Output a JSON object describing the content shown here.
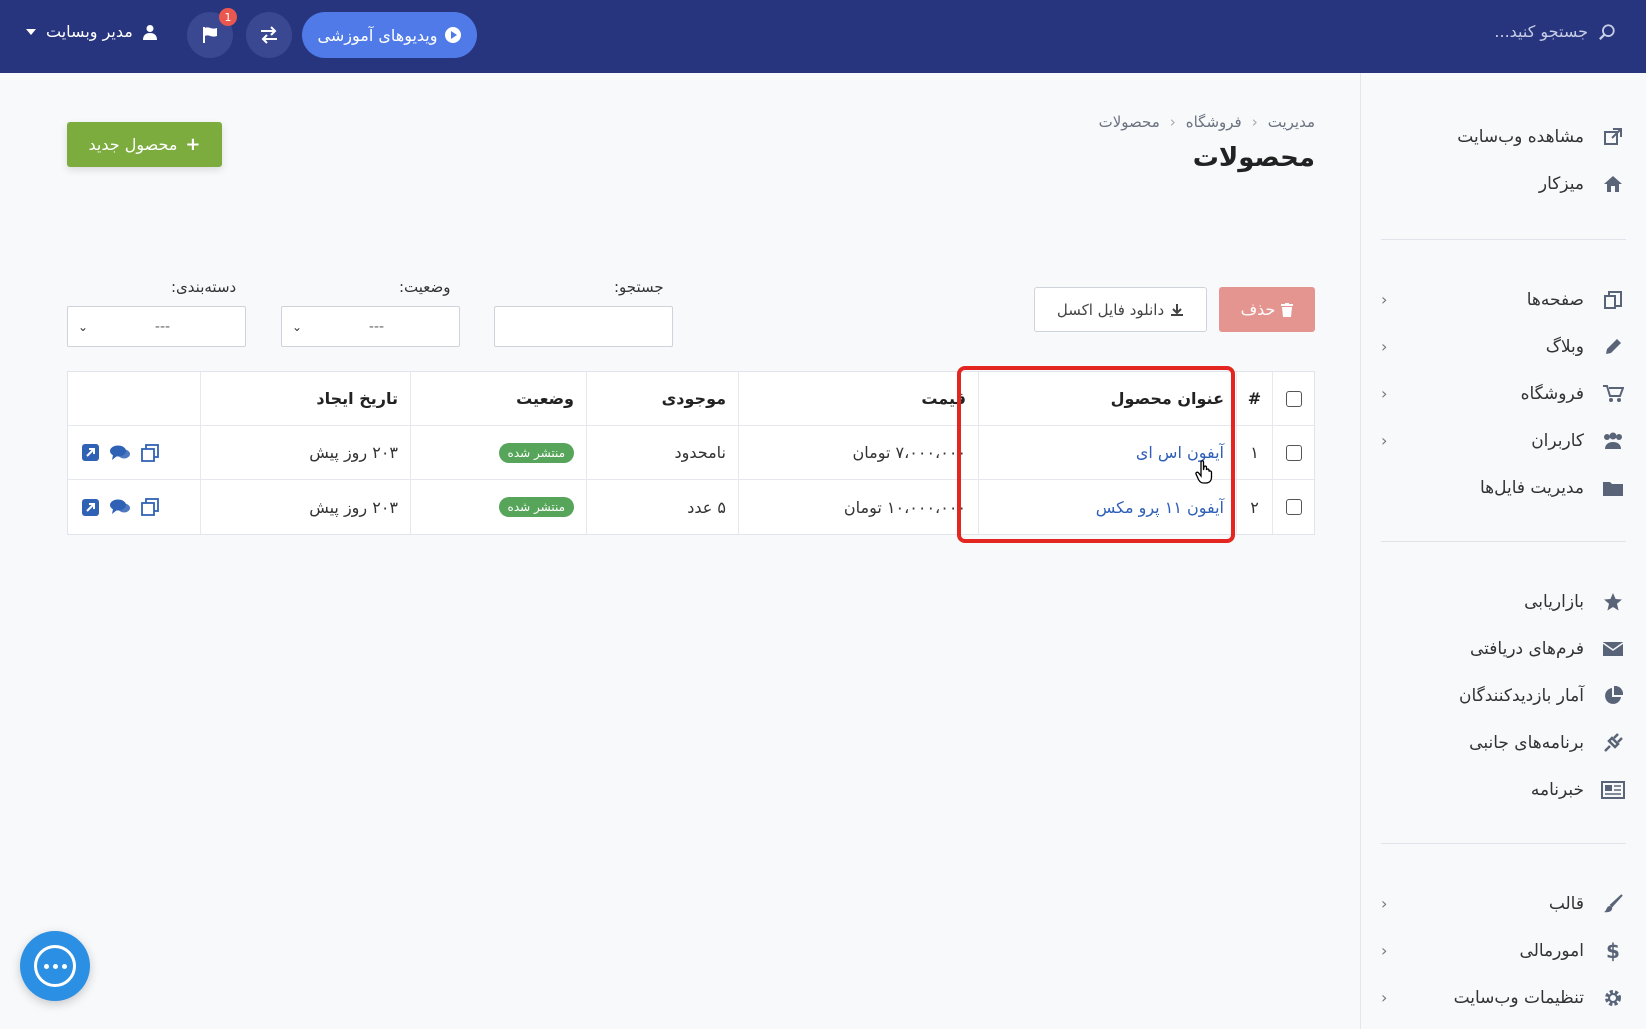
{
  "topbar": {
    "search_placeholder": "جستجو کنید...",
    "video_button": "ویدیوهای آموزشی",
    "notification_count": "1",
    "user_name": "مدیر وبسایت"
  },
  "sidebar": {
    "group1": [
      {
        "label": "مشاهده وب‌سایت",
        "icon": "external-link-icon"
      },
      {
        "label": "میزکار",
        "icon": "home-icon"
      }
    ],
    "group2": [
      {
        "label": "صفحه‌ها",
        "icon": "pages-icon"
      },
      {
        "label": "وبلاگ",
        "icon": "pencil-icon"
      },
      {
        "label": "فروشگاه",
        "icon": "cart-icon"
      },
      {
        "label": "کاربران",
        "icon": "users-icon"
      },
      {
        "label": "مدیریت فایل‌ها",
        "icon": "folder-icon"
      }
    ],
    "group3": [
      {
        "label": "بازاریابی",
        "icon": "star-icon"
      },
      {
        "label": "فرم‌های دریافتی",
        "icon": "envelope-icon"
      },
      {
        "label": "آمار بازدیدکنندگان",
        "icon": "pie-chart-icon"
      },
      {
        "label": "برنامه‌های جانبی",
        "icon": "plug-icon"
      },
      {
        "label": "خبرنامه",
        "icon": "newspaper-icon"
      }
    ],
    "group4": [
      {
        "label": "قالب",
        "icon": "brush-icon"
      },
      {
        "label": "امورمالی",
        "icon": "dollar-icon"
      },
      {
        "label": "تنظیمات وب‌سایت",
        "icon": "gear-icon"
      }
    ]
  },
  "breadcrumb": [
    "مدیریت",
    "فروشگاه",
    "محصولات"
  ],
  "page_title": "محصولات",
  "new_product_button": "محصول جدید",
  "filters": {
    "search_label": "جستجو:",
    "status_label": "وضعیت:",
    "status_value": "---",
    "category_label": "دسته‌بندی:",
    "category_value": "---"
  },
  "buttons": {
    "excel": "دانلود فایل اکسل",
    "delete": "حذف"
  },
  "table": {
    "headers": {
      "num": "#",
      "title": "عنوان محصول",
      "price": "قیمت",
      "stock": "موجودی",
      "status": "وضعیت",
      "date": "تاریخ ایجاد"
    },
    "rows": [
      {
        "num": "۱",
        "title": "آیفون اس ای",
        "price": "۷،۰۰۰،۰۰۰ تومان",
        "stock": "نامحدود",
        "status": "منتشر شده",
        "date": "۲۰۳ روز پیش"
      },
      {
        "num": "۲",
        "title": "آیفون ۱۱ پرو مکس",
        "price": "۱۰،۰۰۰،۰۰۰ تومان",
        "stock": "۵ عدد",
        "status": "منتشر شده",
        "date": "۲۰۳ روز پیش"
      }
    ]
  }
}
